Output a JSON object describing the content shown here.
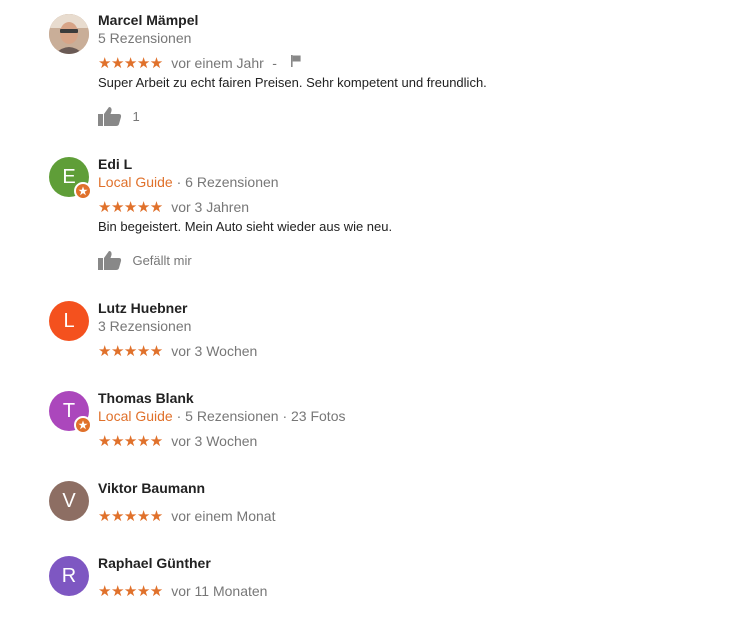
{
  "colors": {
    "star": "#e0712b",
    "local_guide": "#e0712b",
    "meta": "#777777"
  },
  "reviews": [
    {
      "name": "Marcel Mämpel",
      "avatar": {
        "type": "photo"
      },
      "meta_guide": "",
      "meta_rest": "5 Rezensionen",
      "stars": "★★★★★",
      "rating": 5,
      "date": "vor einem Jahr",
      "dash": "-",
      "text": "Super Arbeit zu echt fairen Preisen. Sehr kompetent und freundlich.",
      "like_label": "1"
    },
    {
      "name": "Edi L",
      "avatar": {
        "type": "letter",
        "letter": "E",
        "color": "#5f9e38",
        "badge": true
      },
      "meta_guide": "Local Guide",
      "meta_rest": " · 6 Rezensionen",
      "stars": "★★★★★",
      "rating": 5,
      "date": "vor 3 Jahren",
      "text": "Bin begeistert. Mein Auto sieht wieder aus wie neu.",
      "like_label": "Gefällt mir"
    },
    {
      "name": "Lutz Huebner",
      "avatar": {
        "type": "letter",
        "letter": "L",
        "color": "#f4511e",
        "badge": false
      },
      "meta_guide": "",
      "meta_rest": "3 Rezensionen",
      "stars": "★★★★★",
      "rating": 5,
      "date": "vor 3 Wochen"
    },
    {
      "name": "Thomas Blank",
      "avatar": {
        "type": "letter",
        "letter": "T",
        "color": "#ab47bc",
        "badge": true
      },
      "meta_guide": "Local Guide",
      "meta_rest": " · 5 Rezensionen · 23 Fotos",
      "stars": "★★★★★",
      "rating": 5,
      "date": "vor 3 Wochen"
    },
    {
      "name": "Viktor Baumann",
      "avatar": {
        "type": "letter",
        "letter": "V",
        "color": "#8d6e63",
        "badge": false
      },
      "stars": "★★★★★",
      "rating": 5,
      "date": "vor einem Monat"
    },
    {
      "name": "Raphael Günther",
      "avatar": {
        "type": "letter",
        "letter": "R",
        "color": "#7e57c2",
        "badge": false
      },
      "stars": "★★★★★",
      "rating": 5,
      "date": "vor 11 Monaten"
    }
  ]
}
